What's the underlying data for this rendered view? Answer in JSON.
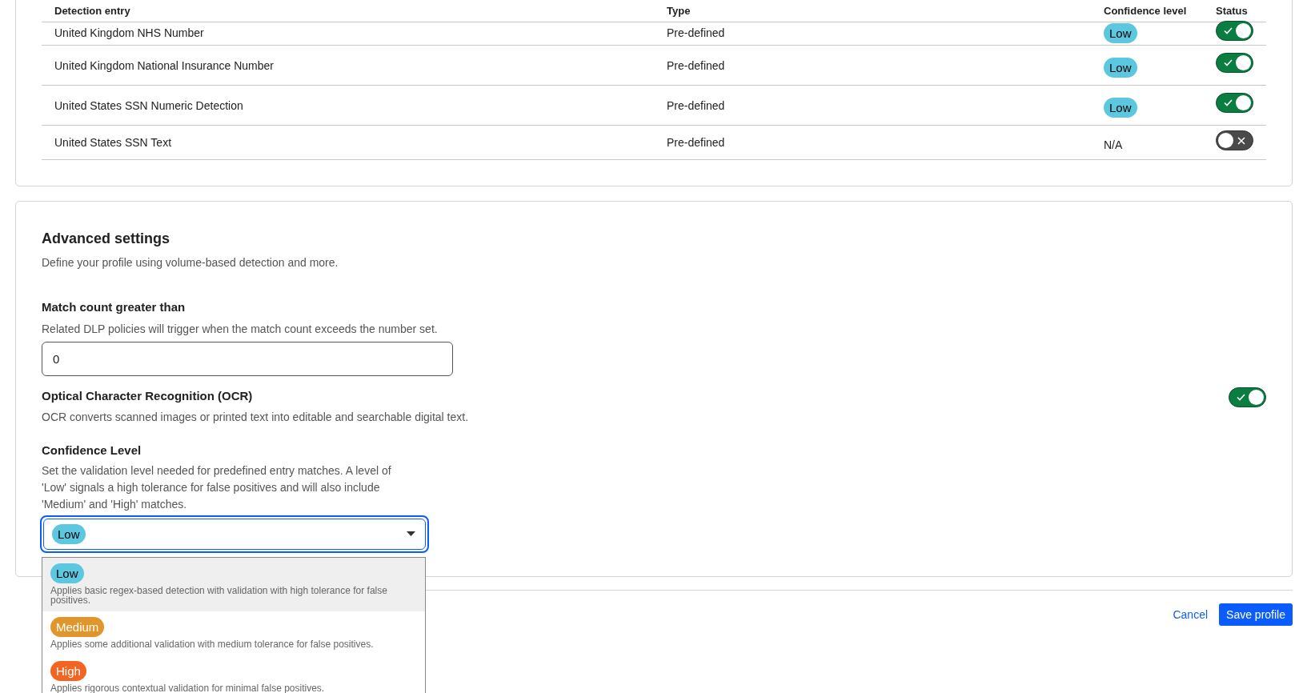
{
  "table": {
    "columns": [
      "Detection entry",
      "Type",
      "Confidence level",
      "Status"
    ],
    "rows": [
      {
        "entry": "United Kingdom NHS Number",
        "type": "Pre-defined",
        "confidence": {
          "kind": "badge",
          "text": "Low"
        },
        "on": true
      },
      {
        "entry": "United Kingdom National Insurance Number",
        "type": "Pre-defined",
        "confidence": {
          "kind": "badge",
          "text": "Low"
        },
        "on": true
      },
      {
        "entry": "United States SSN Numeric Detection",
        "type": "Pre-defined",
        "confidence": {
          "kind": "badge",
          "text": "Low"
        },
        "on": true
      },
      {
        "entry": "United States SSN Text",
        "type": "Pre-defined",
        "confidence": {
          "kind": "text",
          "text": "N/A"
        },
        "on": false
      }
    ]
  },
  "advanced": {
    "title": "Advanced settings",
    "description": "Define your profile using volume-based detection and more.",
    "match_count": {
      "label": "Match count greater than",
      "description": "Related DLP policies will trigger when the match count exceeds the number set.",
      "value": "0"
    },
    "ocr": {
      "label": "Optical Character Recognition (OCR)",
      "description": "OCR converts scanned images or printed text into editable and searchable digital text.",
      "on": true
    },
    "confidence": {
      "label": "Confidence Level",
      "description": "Set the validation level needed for predefined entry matches. A level of 'Low' signals a high tolerance for false positives and will also include 'Medium' and 'High' matches.",
      "value": "Low",
      "expanded": true,
      "options": [
        {
          "label": "Low",
          "color": "#5bc8e0",
          "description": "Applies basic regex-based detection with validation with high tolerance for false positives.",
          "selected": true
        },
        {
          "label": "Medium",
          "color": "#e0962a",
          "description": "Applies some additional validation with medium tolerance for false positives.",
          "selected": false
        },
        {
          "label": "High",
          "color": "#f26422",
          "description": "Applies rigorous contextual validation for minimal false positives.",
          "selected": false
        }
      ]
    }
  },
  "footer": {
    "cancel": "Cancel",
    "save": "Save profile"
  }
}
